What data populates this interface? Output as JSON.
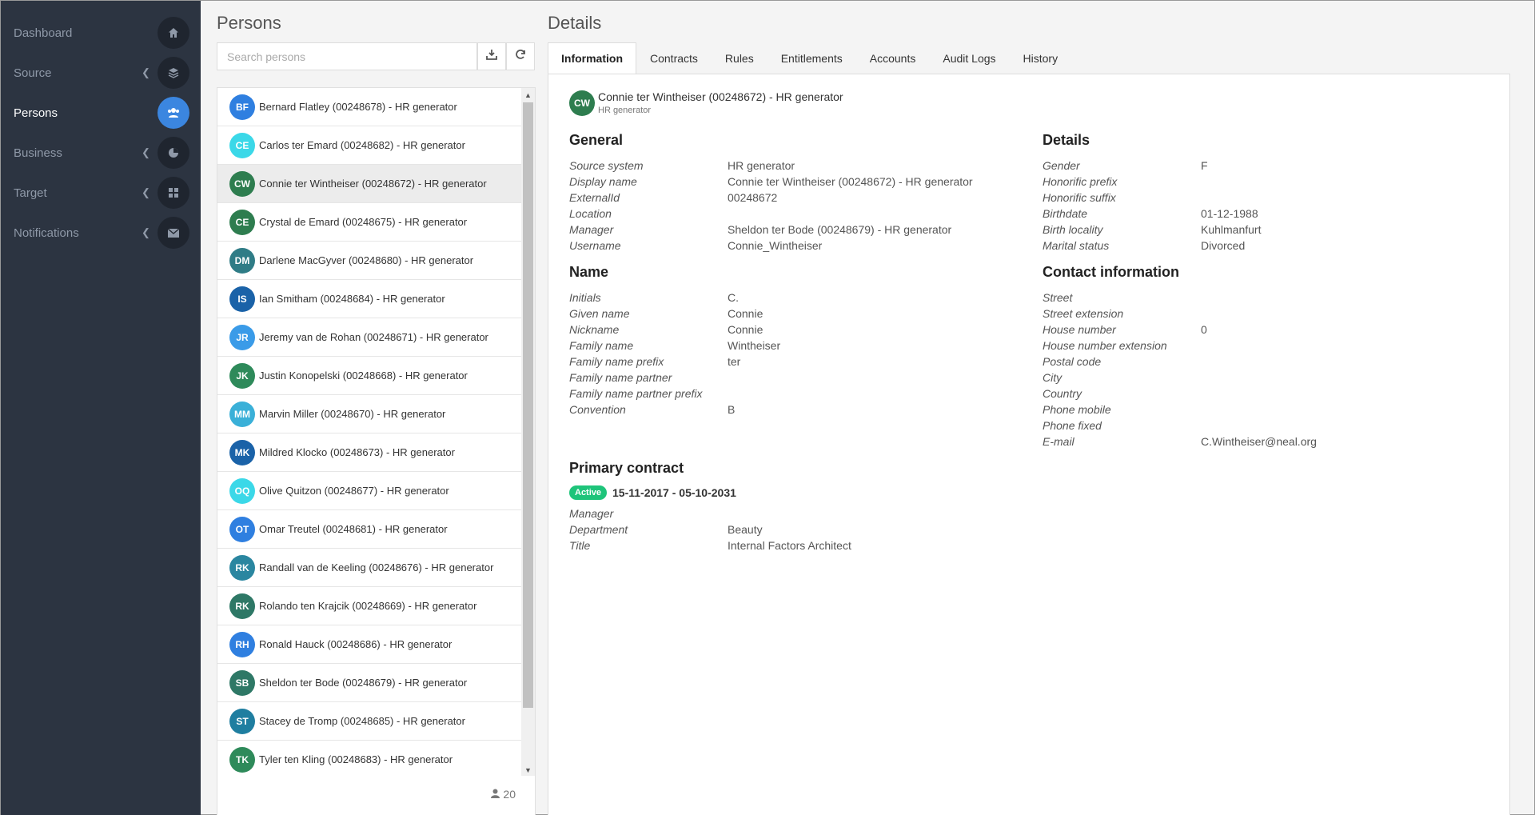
{
  "nav": {
    "items": [
      {
        "label": "Dashboard",
        "icon": "home-icon",
        "chevron": false,
        "active": false
      },
      {
        "label": "Source",
        "icon": "layers-icon",
        "chevron": true,
        "active": false
      },
      {
        "label": "Persons",
        "icon": "users-icon",
        "chevron": false,
        "active": true
      },
      {
        "label": "Business",
        "icon": "pie-chart-icon",
        "chevron": true,
        "active": false
      },
      {
        "label": "Target",
        "icon": "grid-icon",
        "chevron": true,
        "active": false
      },
      {
        "label": "Notifications",
        "icon": "envelope-icon",
        "chevron": true,
        "active": false
      }
    ]
  },
  "persons": {
    "title": "Persons",
    "search_placeholder": "Search persons",
    "count": "20",
    "rows": [
      {
        "initials": "BF",
        "text": "Bernard Flatley (00248678) - HR generator",
        "color": "#2f7fe0"
      },
      {
        "initials": "CE",
        "text": "Carlos ter Emard (00248682) - HR generator",
        "color": "#3bd8e8"
      },
      {
        "initials": "CW",
        "text": "Connie ter Wintheiser (00248672) - HR generator",
        "color": "#2e7d4f",
        "selected": true
      },
      {
        "initials": "CE",
        "text": "Crystal de Emard (00248675) - HR generator",
        "color": "#2e7d4f"
      },
      {
        "initials": "DM",
        "text": "Darlene MacGyver (00248680) - HR generator",
        "color": "#2f7c86"
      },
      {
        "initials": "IS",
        "text": "Ian Smitham (00248684) - HR generator",
        "color": "#1a62a8"
      },
      {
        "initials": "JR",
        "text": "Jeremy van de Rohan (00248671) - HR generator",
        "color": "#3a9be8"
      },
      {
        "initials": "JK",
        "text": "Justin Konopelski (00248668) - HR generator",
        "color": "#2e8a5a"
      },
      {
        "initials": "MM",
        "text": "Marvin Miller (00248670) - HR generator",
        "color": "#3ab0d8"
      },
      {
        "initials": "MK",
        "text": "Mildred Klocko (00248673) - HR generator",
        "color": "#1a62a8"
      },
      {
        "initials": "OQ",
        "text": "Olive Quitzon (00248677) - HR generator",
        "color": "#3bd8e8"
      },
      {
        "initials": "OT",
        "text": "Omar Treutel (00248681) - HR generator",
        "color": "#2f7fe0"
      },
      {
        "initials": "RK",
        "text": "Randall van de Keeling (00248676) - HR generator",
        "color": "#2a86a0"
      },
      {
        "initials": "RK",
        "text": "Rolando ten Krajcik (00248669) - HR generator",
        "color": "#2e7866"
      },
      {
        "initials": "RH",
        "text": "Ronald Hauck (00248686) - HR generator",
        "color": "#2f7fe0"
      },
      {
        "initials": "SB",
        "text": "Sheldon ter Bode (00248679) - HR generator",
        "color": "#2e7866"
      },
      {
        "initials": "ST",
        "text": "Stacey de Tromp (00248685) - HR generator",
        "color": "#1f7ea0"
      },
      {
        "initials": "TK",
        "text": "Tyler ten Kling (00248683) - HR generator",
        "color": "#2e8a5a"
      }
    ]
  },
  "details": {
    "title": "Details",
    "tabs": [
      "Information",
      "Contracts",
      "Rules",
      "Entitlements",
      "Accounts",
      "Audit Logs",
      "History"
    ],
    "active_tab": 0,
    "header": {
      "initials": "CW",
      "name": "Connie ter Wintheiser (00248672) - HR generator",
      "source": "HR generator"
    },
    "general": {
      "title": "General",
      "fields": [
        {
          "label": "Source system",
          "value": "HR generator"
        },
        {
          "label": "Display name",
          "value": "Connie ter Wintheiser (00248672) - HR generator"
        },
        {
          "label": "ExternalId",
          "value": "00248672"
        },
        {
          "label": "Location",
          "value": ""
        },
        {
          "label": "Manager",
          "value": "Sheldon ter Bode (00248679) - HR generator"
        },
        {
          "label": "Username",
          "value": "Connie_Wintheiser"
        }
      ]
    },
    "name": {
      "title": "Name",
      "fields": [
        {
          "label": "Initials",
          "value": "C."
        },
        {
          "label": "Given name",
          "value": "Connie"
        },
        {
          "label": "Nickname",
          "value": "Connie"
        },
        {
          "label": "Family name",
          "value": "Wintheiser"
        },
        {
          "label": "Family name prefix",
          "value": "ter"
        },
        {
          "label": "Family name partner",
          "value": ""
        },
        {
          "label": "Family name partner prefix",
          "value": ""
        },
        {
          "label": "Convention",
          "value": "B"
        }
      ]
    },
    "personal": {
      "title": "Details",
      "fields": [
        {
          "label": "Gender",
          "value": "F"
        },
        {
          "label": "Honorific prefix",
          "value": ""
        },
        {
          "label": "Honorific suffix",
          "value": ""
        },
        {
          "label": "Birthdate",
          "value": "01-12-1988"
        },
        {
          "label": "Birth locality",
          "value": "Kuhlmanfurt"
        },
        {
          "label": "Marital status",
          "value": "Divorced"
        }
      ]
    },
    "contact": {
      "title": "Contact information",
      "fields": [
        {
          "label": "Street",
          "value": ""
        },
        {
          "label": "Street extension",
          "value": ""
        },
        {
          "label": "House number",
          "value": "0"
        },
        {
          "label": "House number extension",
          "value": ""
        },
        {
          "label": "Postal code",
          "value": ""
        },
        {
          "label": "City",
          "value": ""
        },
        {
          "label": "Country",
          "value": ""
        },
        {
          "label": "Phone mobile",
          "value": ""
        },
        {
          "label": "Phone fixed",
          "value": ""
        },
        {
          "label": "E-mail",
          "value": "C.Wintheiser@neal.org"
        }
      ]
    },
    "contract": {
      "title": "Primary contract",
      "status": "Active",
      "status_color": "#1ec47a",
      "dates": "15-11-2017 - 05-10-2031",
      "fields": [
        {
          "label": "Manager",
          "value": ""
        },
        {
          "label": "Department",
          "value": "Beauty"
        },
        {
          "label": "Title",
          "value": "Internal Factors Architect"
        }
      ]
    }
  }
}
